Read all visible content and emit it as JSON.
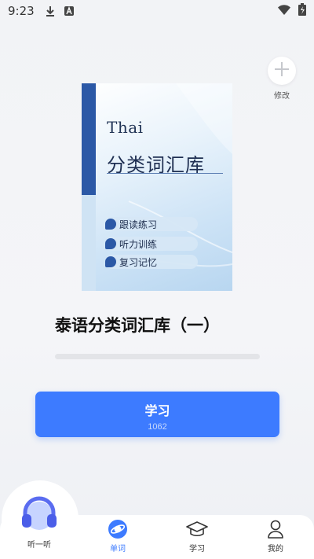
{
  "status_bar": {
    "time": "9:23",
    "icons": [
      "download-icon",
      "a-badge-icon",
      "wifi-icon",
      "battery-charging-icon"
    ]
  },
  "header": {
    "edit_label": "修改"
  },
  "book": {
    "cover": {
      "en_title": "Thai",
      "cn_title": "分类词汇库",
      "features": [
        "跟读练习",
        "听力训练",
        "复习记忆"
      ],
      "accent_color": "#2b58a6"
    },
    "title": "泰语分类词汇库（一）",
    "progress": 0
  },
  "study_button": {
    "label": "学习",
    "count": "1062",
    "color": "#3d7bff"
  },
  "tab_bar": {
    "active": "words",
    "items": [
      {
        "id": "listen",
        "label": "听一听",
        "icon": "headphones-icon"
      },
      {
        "id": "words",
        "label": "单词",
        "icon": "planet-icon"
      },
      {
        "id": "study",
        "label": "学习",
        "icon": "graduation-cap-icon"
      },
      {
        "id": "me",
        "label": "我的",
        "icon": "person-icon"
      }
    ]
  }
}
